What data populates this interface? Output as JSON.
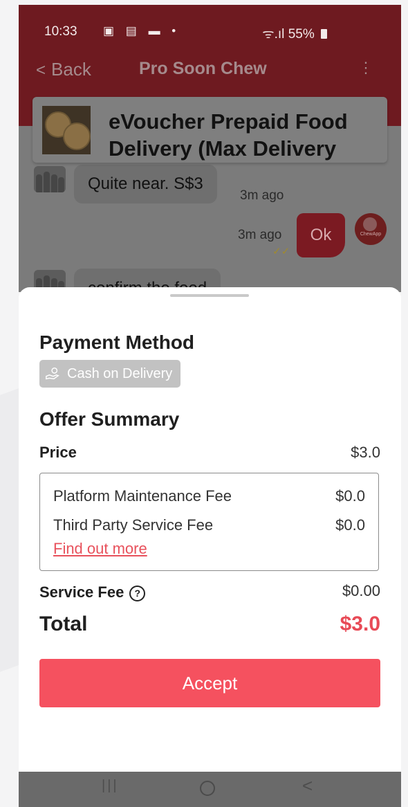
{
  "status_bar": {
    "time": "10:33",
    "notification_icons": "▣ ▤ ▬ •",
    "signal_icons": "ᯤ.ıl",
    "battery": "55%"
  },
  "nav": {
    "back_chevron": "<",
    "back_label": "Back",
    "title": "Pro Soon Chew",
    "menu_icon": "⋮"
  },
  "product": {
    "name": "eVoucher Prepaid Food Delivery (Max Delivery"
  },
  "chat": {
    "message_1_text": "Quite near. S$3",
    "message_1_time": "3m ago",
    "message_2_time": "3m ago",
    "message_2_text": "Ok",
    "message_2_ticks": "✓✓",
    "message_3_text": "confirm the food",
    "my_avatar_label": "ChewApp"
  },
  "sheet": {
    "payment_heading": "Payment Method",
    "payment_option": "Cash on Delivery",
    "offer_heading": "Offer Summary",
    "price_label": "Price",
    "price_value": "$3.0",
    "fees": [
      {
        "label": "Platform Maintenance Fee",
        "value": "$0.0"
      },
      {
        "label": "Third Party Service Fee",
        "value": "$0.0"
      }
    ],
    "find_out_more": "Find out more",
    "service_fee_label": "Service Fee",
    "service_fee_help": "?",
    "service_fee_value": "$0.00",
    "total_label": "Total",
    "total_value": "$3.0",
    "accept_label": "Accept"
  },
  "system_nav": {
    "recents": "|||",
    "back": "<"
  },
  "colors": {
    "header": "#6e1a20",
    "accent": "#f5515f",
    "total": "#e84a56",
    "link": "#e8515c"
  }
}
